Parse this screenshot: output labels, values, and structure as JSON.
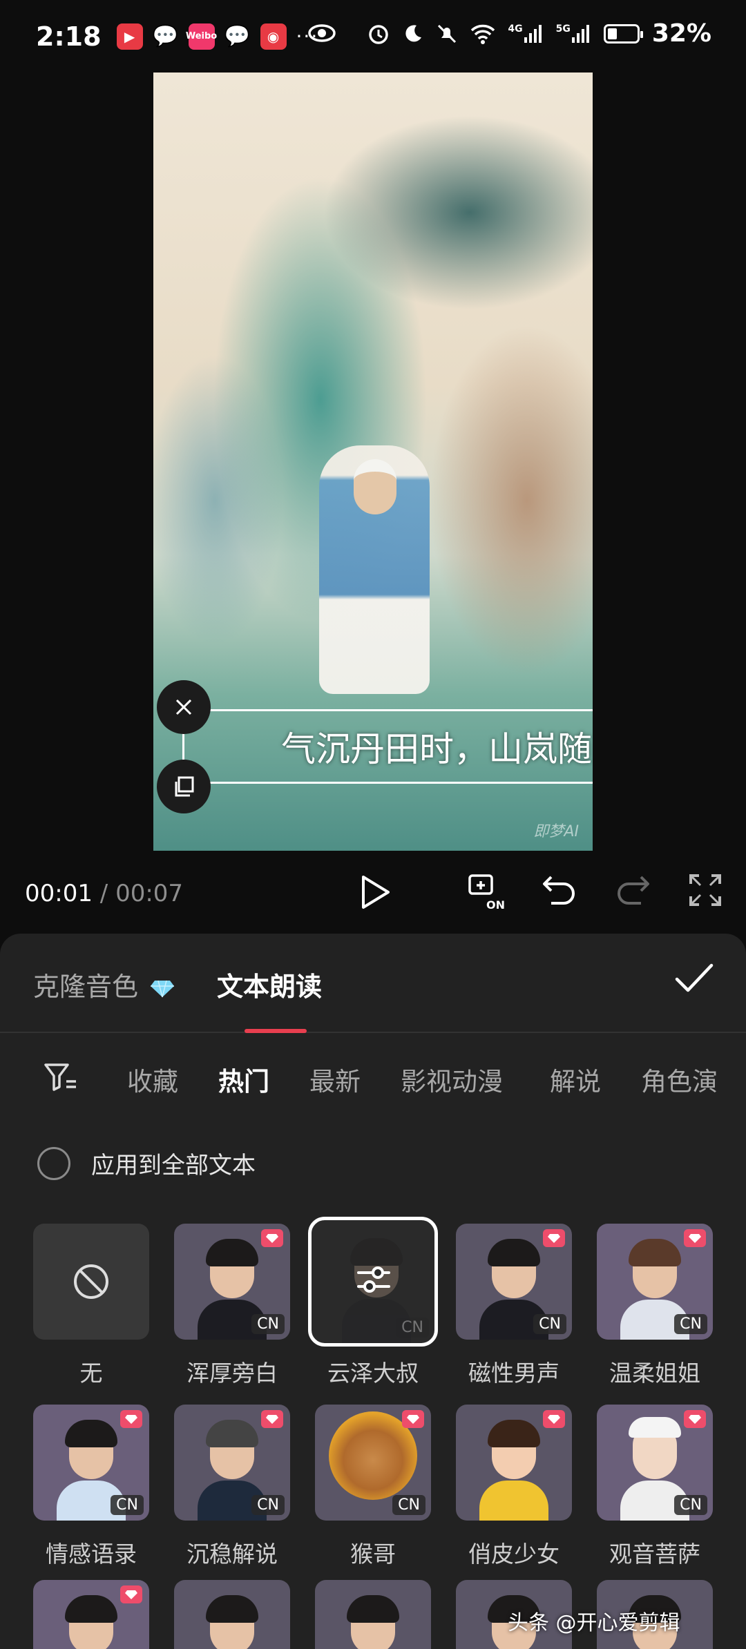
{
  "status_bar": {
    "time": "2:18",
    "battery_level": "32%",
    "battery_fraction": 0.32,
    "network_1": "4G",
    "network_2": "5G",
    "notif_pink_label": "Weibo",
    "more": "···"
  },
  "preview": {
    "subtitle": "气沉丹田时，山岚随",
    "watermark": "即梦AI"
  },
  "playback": {
    "current_time": "00:01",
    "separator": " / ",
    "total_time": "00:07"
  },
  "panel": {
    "tabs": [
      {
        "label": "克隆音色",
        "active": false
      },
      {
        "label": "文本朗读",
        "active": true
      }
    ],
    "categories": [
      {
        "label": "收藏",
        "active": false
      },
      {
        "label": "热门",
        "active": true
      },
      {
        "label": "最新",
        "active": false
      },
      {
        "label": "影视动漫",
        "active": false
      },
      {
        "label": "解说",
        "active": false
      },
      {
        "label": "角色演",
        "active": false
      }
    ],
    "apply_all_label": "应用到全部文本",
    "cn_badge": "CN",
    "voices": [
      {
        "name": "无",
        "type": "none"
      },
      {
        "name": "浑厚旁白",
        "type": "male",
        "premium": true,
        "cn": true
      },
      {
        "name": "云泽大叔",
        "type": "selected",
        "premium": false,
        "cn": true
      },
      {
        "name": "磁性男声",
        "type": "male",
        "premium": true,
        "cn": true
      },
      {
        "name": "温柔姐姐",
        "type": "female",
        "premium": true,
        "cn": true
      },
      {
        "name": "情感语录",
        "type": "female",
        "premium": true,
        "cn": true
      },
      {
        "name": "沉稳解说",
        "type": "male",
        "premium": true,
        "cn": true
      },
      {
        "name": "猴哥",
        "type": "monkey",
        "premium": true,
        "cn": true
      },
      {
        "name": "俏皮少女",
        "type": "girl",
        "premium": true,
        "cn": false
      },
      {
        "name": "观音菩萨",
        "type": "deity",
        "premium": true,
        "cn": true
      }
    ]
  },
  "footer_watermark": "头条 @开心爱剪辑",
  "colors": {
    "accent": "#e83f4f",
    "panel_bg": "#222222",
    "premium_badge": "#ee4d6b"
  }
}
